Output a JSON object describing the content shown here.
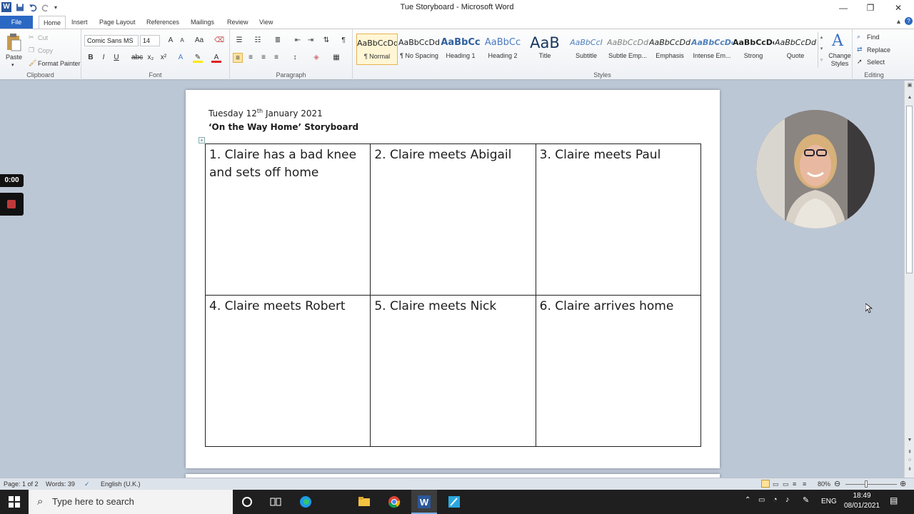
{
  "window": {
    "title": "Tue Storyboard - Microsoft Word"
  },
  "tabs": [
    "File",
    "Home",
    "Insert",
    "Page Layout",
    "References",
    "Mailings",
    "Review",
    "View"
  ],
  "ribbon": {
    "clipboard": {
      "paste": "Paste",
      "cut": "Cut",
      "copy": "Copy",
      "format_painter": "Format Painter",
      "label": "Clipboard"
    },
    "font": {
      "name": "Comic Sans MS",
      "size": "14",
      "label": "Font"
    },
    "paragraph": {
      "label": "Paragraph"
    },
    "styles": {
      "label": "Styles",
      "items": [
        {
          "preview": "AaBbCcDd",
          "name": "¶ Normal"
        },
        {
          "preview": "AaBbCcDd",
          "name": "¶ No Spacing"
        },
        {
          "preview": "AaBbCc",
          "name": "Heading 1"
        },
        {
          "preview": "AaBbCc",
          "name": "Heading 2"
        },
        {
          "preview": "AaB",
          "name": "Title"
        },
        {
          "preview": "AaBbCcI",
          "name": "Subtitle"
        },
        {
          "preview": "AaBbCcDd",
          "name": "Subtle Emp..."
        },
        {
          "preview": "AaBbCcDd",
          "name": "Emphasis"
        },
        {
          "preview": "AaBbCcDc",
          "name": "Intense Em..."
        },
        {
          "preview": "AaBbCcDc",
          "name": "Strong"
        },
        {
          "preview": "AaBbCcDd",
          "name": "Quote"
        }
      ],
      "change_styles": "Change Styles"
    },
    "editing": {
      "find": "Find",
      "replace": "Replace",
      "select": "Select",
      "label": "Editing"
    }
  },
  "document": {
    "date_prefix": "Tuesday 12",
    "date_sup": "th",
    "date_suffix": " January 2021",
    "heading": "‘On the Way Home’ Storyboard",
    "cells": [
      "1. Claire has a bad knee and sets off home",
      "2. Claire meets Abigail",
      "3. Claire meets Paul",
      "4. Claire meets Robert",
      "5. Claire meets Nick",
      "6. Claire arrives home"
    ]
  },
  "recording": {
    "timer": "0:00"
  },
  "statusbar": {
    "page": "Page: 1 of 2",
    "words": "Words: 39",
    "language": "English (U.K.)",
    "zoom": "80%"
  },
  "taskbar": {
    "search_placeholder": "Type here to search",
    "lang": "ENG",
    "time": "18:49",
    "date": "08/01/2021"
  }
}
